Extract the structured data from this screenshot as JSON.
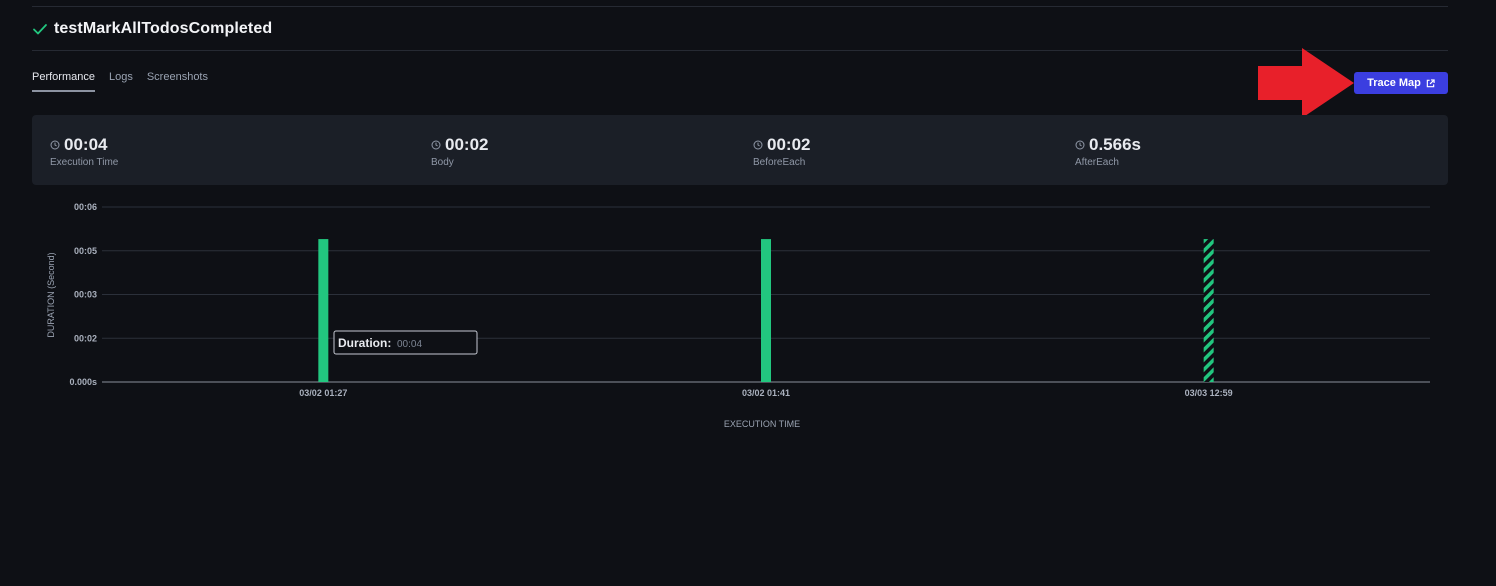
{
  "test": {
    "title": "testMarkAllTodosCompleted",
    "status": "passed"
  },
  "tabs": [
    {
      "label": "Performance",
      "active": true
    },
    {
      "label": "Logs",
      "active": false
    },
    {
      "label": "Screenshots",
      "active": false
    }
  ],
  "trace_button": {
    "label": "Trace Map"
  },
  "stats": [
    {
      "value": "00:04",
      "label": "Execution Time"
    },
    {
      "value": "00:02",
      "label": "Body"
    },
    {
      "value": "00:02",
      "label": "BeforeEach"
    },
    {
      "value": "0.566s",
      "label": "AfterEach"
    }
  ],
  "colors": {
    "accent": "#3b3ee0",
    "success": "#22c77f",
    "arrow": "#e8202a",
    "card": "#1b1f27",
    "background": "#0e1015"
  },
  "tooltip": {
    "label": "Duration:",
    "value": "00:04"
  },
  "chart_data": {
    "type": "bar",
    "categories": [
      "03/02 01:27",
      "03/02 01:41",
      "03/03 12:59"
    ],
    "values": [
      4.9,
      4.9,
      4.9
    ],
    "bar_styles": [
      "solid",
      "solid",
      "striped"
    ],
    "xlabel": "EXECUTION TIME",
    "ylabel": "DURATION (Second)",
    "ytick_values": [
      0,
      1.5,
      3,
      4.5,
      6
    ],
    "ytick_labels": [
      "0.000s",
      "00:02",
      "00:03",
      "00:05",
      "00:06"
    ],
    "ylim": [
      0,
      6
    ],
    "grid": true
  }
}
